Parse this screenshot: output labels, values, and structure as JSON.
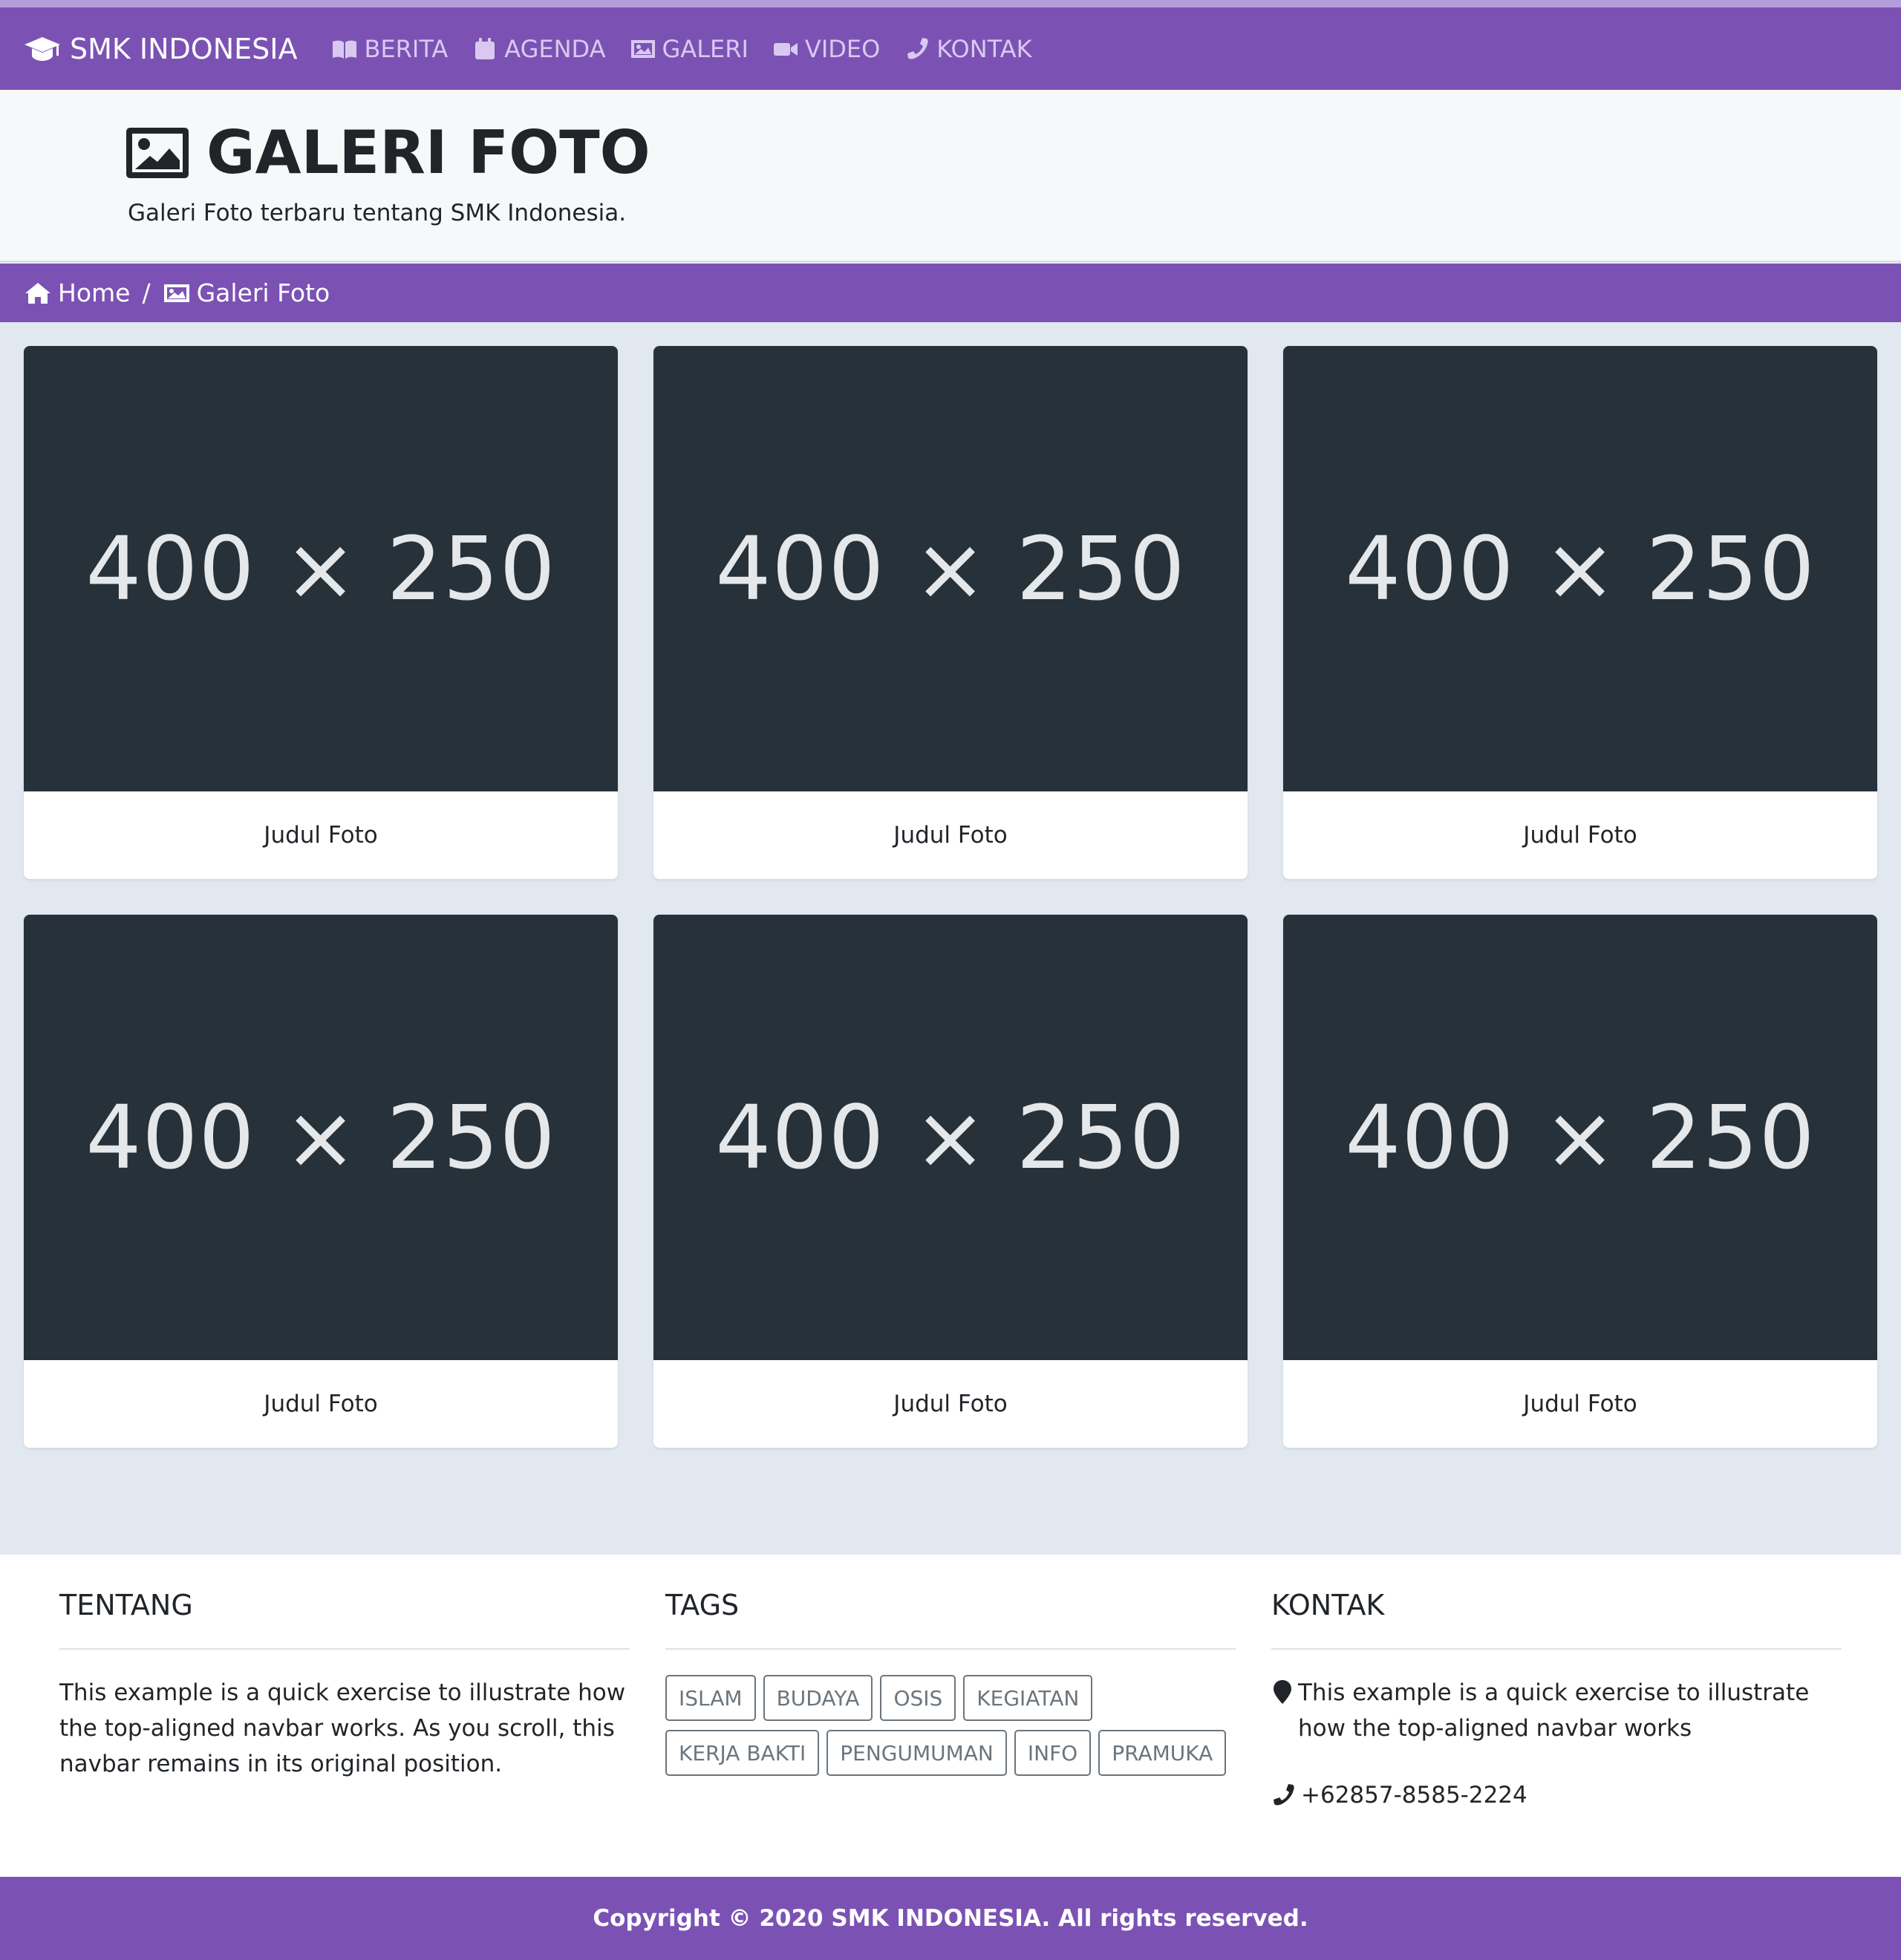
{
  "colors": {
    "primary": "#7b52b4",
    "accent_strip": "#b39ddb",
    "placeholder_bg": "#263139",
    "page_bg": "#e2e8f0"
  },
  "navbar": {
    "brand": "SMK INDONESIA",
    "brand_icon": "graduation-cap-icon",
    "items": [
      {
        "label": "BERITA",
        "icon": "book-icon"
      },
      {
        "label": "AGENDA",
        "icon": "calendar-icon"
      },
      {
        "label": "GALERI",
        "icon": "image-icon"
      },
      {
        "label": "VIDEO",
        "icon": "video-camera-icon"
      },
      {
        "label": "KONTAK",
        "icon": "phone-icon"
      }
    ]
  },
  "header": {
    "title": "GALERI FOTO",
    "title_icon": "image-icon",
    "subtitle": "Galeri Foto terbaru tentang SMK Indonesia."
  },
  "breadcrumb": {
    "home": "Home",
    "separator": "/",
    "current": "Galeri Foto"
  },
  "gallery": {
    "items": [
      {
        "image_text": "400 × 250",
        "caption": "Judul Foto"
      },
      {
        "image_text": "400 × 250",
        "caption": "Judul Foto"
      },
      {
        "image_text": "400 × 250",
        "caption": "Judul Foto"
      },
      {
        "image_text": "400 × 250",
        "caption": "Judul Foto"
      },
      {
        "image_text": "400 × 250",
        "caption": "Judul Foto"
      },
      {
        "image_text": "400 × 250",
        "caption": "Judul Foto"
      }
    ]
  },
  "footer": {
    "tentang": {
      "title": "TENTANG",
      "text": "This example is a quick exercise to illustrate how the top-aligned navbar works. As you scroll, this navbar remains in its original position."
    },
    "tags": {
      "title": "TAGS",
      "items": [
        "ISLAM",
        "BUDAYA",
        "OSIS",
        "KEGIATAN",
        "KERJA BAKTI",
        "PENGUMUMAN",
        "INFO",
        "PRAMUKA"
      ]
    },
    "kontak": {
      "title": "KONTAK",
      "address": "This example is a quick exercise to illustrate how the top-aligned navbar works",
      "address_icon": "map-marker-icon",
      "phone": "+62857-8585-2224",
      "phone_icon": "phone-icon"
    }
  },
  "copyright": "Copyright © 2020 SMK INDONESIA. All rights reserved."
}
